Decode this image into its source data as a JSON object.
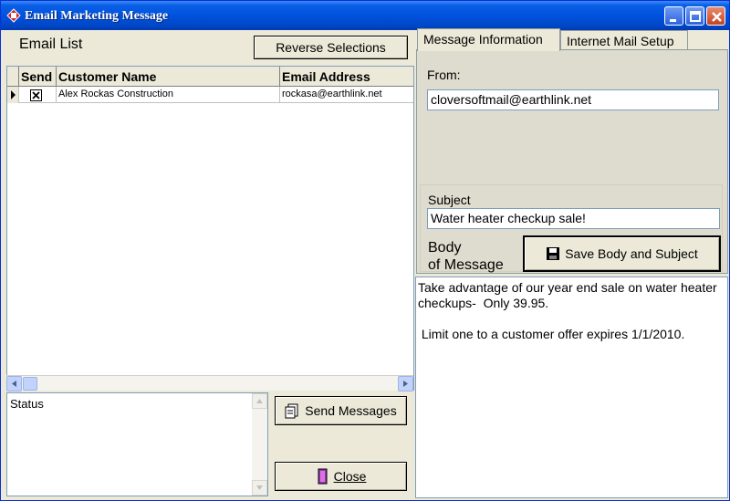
{
  "window": {
    "title": "Email Marketing Message",
    "accent": "#0052DE"
  },
  "left": {
    "email_list_label": "Email List",
    "reverse_button": "Reverse Selections",
    "grid": {
      "columns": [
        "Send",
        "Customer Name",
        "Email Address"
      ],
      "rows": [
        {
          "send": true,
          "name": "Alex Rockas Construction",
          "email": "rockasa@earthlink.net"
        }
      ]
    },
    "status_label": "Status",
    "send_button": "Send Messages",
    "close_button": "Close"
  },
  "right": {
    "tabs": [
      "Message Information",
      "Internet Mail Setup"
    ],
    "from_label": "From:",
    "from_value": "cloversoftmail@earthlink.net",
    "subject_label": "Subject",
    "subject_value": "Water heater checkup sale!",
    "body_label_line1": "Body",
    "body_label_line2": "of Message",
    "save_button": "Save Body and Subject",
    "message_body": "Take advantage of our year end sale on water heater checkups-  Only 39.95.\n\n Limit one to a customer offer expires 1/1/2010."
  }
}
